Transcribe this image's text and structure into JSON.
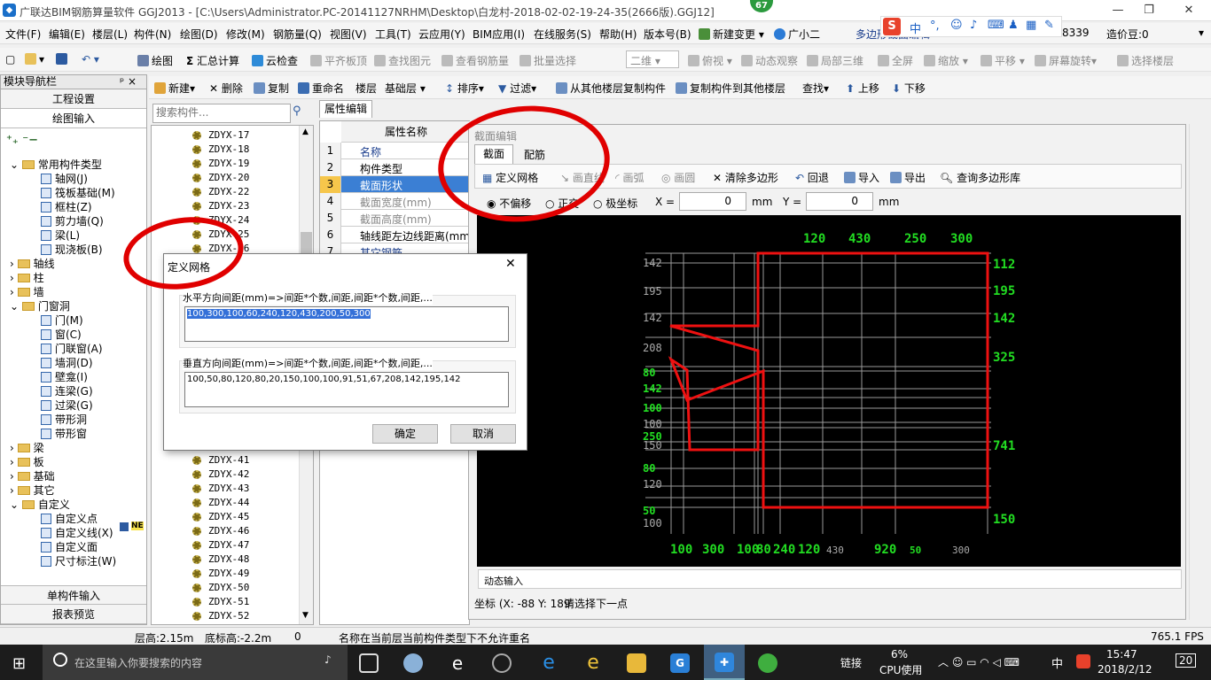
{
  "app": {
    "title": "广联达BIM钢筋算量软件 GGJ2013 - [C:\\Users\\Administrator.PC-20141127NRHM\\Desktop\\白龙村-2018-02-02-19-24-35(2666版).GGJ12]",
    "badge": "67"
  },
  "menubar": [
    "文件(F)",
    "编辑(E)",
    "楼层(L)",
    "构件(N)",
    "绘图(D)",
    "修改(M)",
    "钢筋量(Q)",
    "视图(V)",
    "工具(T)",
    "云应用(Y)",
    "BIM应用(I)",
    "在线服务(S)",
    "帮助(H)",
    "版本号(B)",
    "新建变更",
    "广小二"
  ],
  "menubar_right": {
    "text1": "多边形截面编辑",
    "num": "8339",
    "cost": "造价豆:0"
  },
  "ime": {
    "label": "中"
  },
  "toolbar1": [
    "绘图",
    "汇总计算",
    "云检查",
    "平齐板顶",
    "查找图元",
    "查看钢筋量",
    "批量选择",
    "二维",
    "俯视",
    "动态观察",
    "局部三维",
    "全屏",
    "缩放",
    "平移",
    "屏幕旋转",
    "选择楼层"
  ],
  "toolbar2": [
    "新建",
    "删除",
    "复制",
    "重命名",
    "楼层",
    "基础层",
    "排序",
    "过滤",
    "从其他楼层复制构件",
    "复制构件到其他楼层",
    "查找",
    "上移",
    "下移"
  ],
  "nav": {
    "header": "模块导航栏",
    "pin": "ᵖ  ×",
    "btn1": "工程设置",
    "btn2": "绘图输入",
    "btn3": "单构件输入",
    "btn4": "报表预览",
    "tree": [
      {
        "t": "常用构件类型",
        "lvl": 0,
        "f": 1,
        "e": "v"
      },
      {
        "t": "轴网(J)",
        "lvl": 1
      },
      {
        "t": "筏板基础(M)",
        "lvl": 1
      },
      {
        "t": "框柱(Z)",
        "lvl": 1
      },
      {
        "t": "剪力墙(Q)",
        "lvl": 1
      },
      {
        "t": "梁(L)",
        "lvl": 1
      },
      {
        "t": "现浇板(B)",
        "lvl": 1
      },
      {
        "t": "轴线",
        "lvl": 0,
        "f": 1,
        "e": ">"
      },
      {
        "t": "柱",
        "lvl": 0,
        "f": 1,
        "e": ">"
      },
      {
        "t": "墙",
        "lvl": 0,
        "f": 1,
        "e": ">"
      },
      {
        "t": "门窗洞",
        "lvl": 0,
        "f": 1,
        "e": "v"
      },
      {
        "t": "门(M)",
        "lvl": 1
      },
      {
        "t": "窗(C)",
        "lvl": 1
      },
      {
        "t": "门联窗(A)",
        "lvl": 1
      },
      {
        "t": "墙洞(D)",
        "lvl": 1
      },
      {
        "t": "壁龛(I)",
        "lvl": 1
      },
      {
        "t": "连梁(G)",
        "lvl": 1
      },
      {
        "t": "过梁(G)",
        "lvl": 1
      },
      {
        "t": "带形洞",
        "lvl": 1
      },
      {
        "t": "带形窗",
        "lvl": 1
      },
      {
        "t": "梁",
        "lvl": 0,
        "f": 1,
        "e": ">"
      },
      {
        "t": "板",
        "lvl": 0,
        "f": 1,
        "e": ">"
      },
      {
        "t": "基础",
        "lvl": 0,
        "f": 1,
        "e": ">"
      },
      {
        "t": "其它",
        "lvl": 0,
        "f": 1,
        "e": ">"
      },
      {
        "t": "自定义",
        "lvl": 0,
        "f": 1,
        "e": "v"
      },
      {
        "t": "自定义点",
        "lvl": 1
      },
      {
        "t": "自定义线(X)",
        "lvl": 1
      },
      {
        "t": "自定义面",
        "lvl": 1
      },
      {
        "t": "尺寸标注(W)",
        "lvl": 1
      }
    ]
  },
  "search": {
    "placeholder": "搜索构件..."
  },
  "complist": [
    "ZDYX-17",
    "ZDYX-18",
    "ZDYX-19",
    "ZDYX-20",
    "ZDYX-22",
    "ZDYX-23",
    "ZDYX-24",
    "ZDYX-25",
    "ZDYX-26",
    "ZDYX-41",
    "ZDYX-42",
    "ZDYX-43",
    "ZDYX-44",
    "ZDYX-45",
    "ZDYX-46",
    "ZDYX-47",
    "ZDYX-48",
    "ZDYX-49",
    "ZDYX-50",
    "ZDYX-51",
    "ZDYX-52"
  ],
  "props": {
    "tab": "属性编辑",
    "header": "属性名称",
    "rows": [
      {
        "n": "1",
        "v": "名称"
      },
      {
        "n": "2",
        "v": "构件类型"
      },
      {
        "n": "3",
        "v": "截面形状"
      },
      {
        "n": "4",
        "v": "截面宽度(mm)"
      },
      {
        "n": "5",
        "v": "截面高度(mm)"
      },
      {
        "n": "6",
        "v": "轴线距左边线距离(mm)"
      },
      {
        "n": "7",
        "v": "其它钢筋"
      }
    ]
  },
  "editor": {
    "title": "截面编辑",
    "tabs": [
      "截面",
      "配筋"
    ],
    "tools": [
      "定义网格",
      "画直线",
      "画弧",
      "画圆",
      "清除多边形",
      "回退",
      "导入",
      "导出",
      "查询多边形库"
    ],
    "options": [
      "不偏移",
      "正交",
      "极坐标"
    ],
    "x_label": "X =",
    "x_value": "0",
    "y_label": "Y =",
    "y_value": "0",
    "unit": "mm",
    "dyn": "动态输入",
    "coord": "坐标 (X: -88 Y: 189",
    "hint": "请选择下一点"
  },
  "canvas": {
    "top_dims": [
      "120",
      "430",
      "250",
      "300"
    ],
    "right_dims": [
      "112",
      "195",
      "142",
      "325",
      "741",
      "150"
    ],
    "left_ticks": [
      "142",
      "195",
      "142",
      "208",
      "80",
      "142",
      "100",
      "100",
      "250",
      "150",
      "80",
      "120",
      "50",
      "100"
    ],
    "bottom_dims": [
      "100",
      "300",
      "100",
      "80",
      "240",
      "120",
      "430",
      "920",
      "50",
      "300"
    ]
  },
  "dialog": {
    "title": "定义网格",
    "h_label": "水平方向间距(mm)=>间距*个数,间距,间距*个数,间距,...",
    "h_value": "100,300,100,60,240,120,430,200,50,300",
    "v_label": "垂直方向间距(mm)=>间距*个数,间距,间距*个数,间距,...",
    "v_value": "100,50,80,120,80,20,150,100,100,91,51,67,208,142,195,142",
    "ok": "确定",
    "cancel": "取消"
  },
  "status": {
    "floor_h": "层高:2.15m",
    "bottom_h": "底标高:-2.2m",
    "num": "0",
    "msg": "名称在当前层当前构件类型下不允许重名",
    "fps": "765.1 FPS"
  },
  "taskbar": {
    "search": "在这里输入你要搜索的内容",
    "link": "链接",
    "cpu": "6%",
    "cpu_label": "CPU使用",
    "lang": "中",
    "time": "15:47",
    "date": "2018/2/12",
    "notif": "20"
  }
}
